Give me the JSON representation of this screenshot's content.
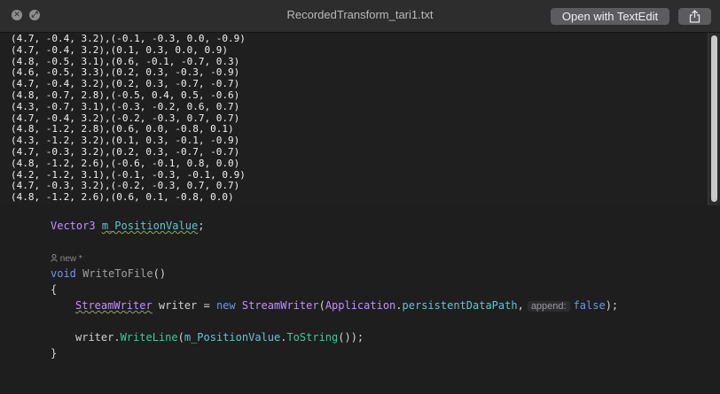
{
  "window": {
    "title": "RecordedTransform_tari1.txt",
    "open_button_label": "Open with TextEdit",
    "close_glyph": "✕",
    "fullscreen_glyph": "⤢"
  },
  "file_lines": [
    "(4.7, -0.4, 3.2),(-0.1, -0.3, 0.0, -0.9)",
    "(4.7, -0.4, 3.2),(0.1, 0.3, 0.0, 0.9)",
    "(4.8, -0.5, 3.1),(0.6, -0.1, -0.7, 0.3)",
    "(4.6, -0.5, 3.3),(0.2, 0.3, -0.3, -0.9)",
    "(4.7, -0.4, 3.2),(0.2, 0.3, -0.7, -0.7)",
    "(4.8, -0.7, 2.8),(-0.5, 0.4, 0.5, -0.6)",
    "(4.3, -0.7, 3.1),(-0.3, -0.2, 0.6, 0.7)",
    "(4.7, -0.4, 3.2),(-0.2, -0.3, 0.7, 0.7)",
    "(4.8, -1.2, 2.8),(0.6, 0.0, -0.8, 0.1)",
    "(4.3, -1.2, 3.2),(0.1, 0.3, -0.1, -0.9)",
    "(4.7, -0.3, 3.2),(0.2, 0.3, -0.7, -0.7)",
    "(4.8, -1.2, 2.6),(-0.6, -0.1, 0.8, 0.0)",
    "(4.2, -1.2, 3.1),(-0.1, -0.3, -0.1, 0.9)",
    "(4.7, -0.3, 3.2),(-0.2, -0.3, 0.7, 0.7)",
    "(4.8, -1.2, 2.6),(0.6, 0.1, -0.8, 0.0)"
  ],
  "code": {
    "field_type": "Vector3",
    "field_name": "m_PositionValue",
    "semicolon": ";",
    "codelens": "new *",
    "method_kw": "void",
    "method_name": "WriteToFile",
    "parens": "()",
    "open_brace": "{",
    "close_brace": "}",
    "l1_type": "StreamWriter",
    "l1_var": " writer = ",
    "l1_new": "new",
    "l1_type2": "StreamWriter",
    "l1_paren": "(",
    "l1_app": "Application",
    "l1_dot": ".",
    "l1_member": "persistentDataPath",
    "l1_comma": ",",
    "l1_hint": "append:",
    "l1_false": "false",
    "l1_end": ");",
    "l2_writer": "writer.",
    "l2_method": "WriteLine",
    "l2_open": "(",
    "l2_field": "m_PositionValue",
    "l2_dot": ".",
    "l2_tostring": "ToString",
    "l2_end": "());"
  },
  "colors": {
    "keyword": "#6c95eb",
    "type": "#c191ff",
    "member": "#66c3cc",
    "method": "#39cc9b"
  },
  "icons": [
    "close-icon",
    "fullscreen-icon",
    "share-icon",
    "person-icon"
  ]
}
